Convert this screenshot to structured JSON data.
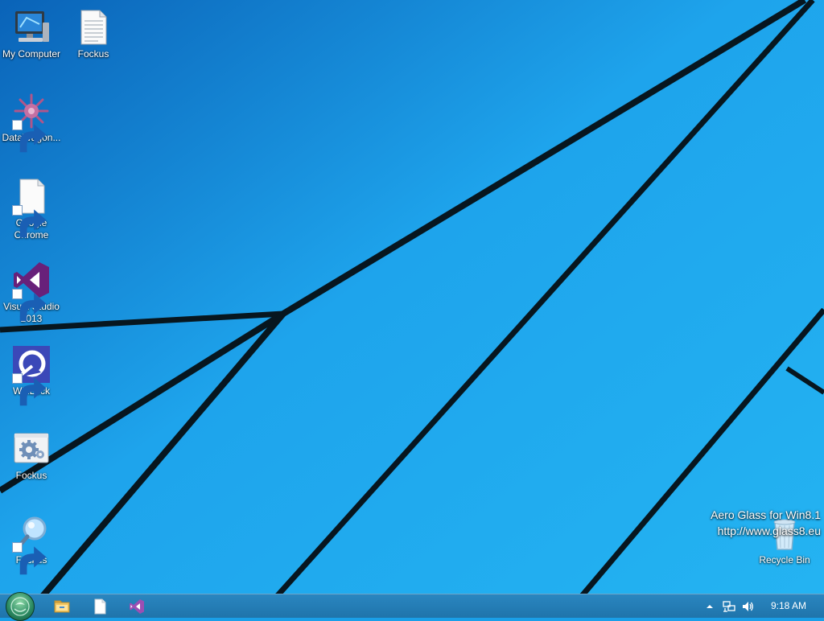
{
  "desktop": {
    "icons": [
      {
        "label": "My Computer",
        "icon": "computer-icon",
        "shortcut": false
      },
      {
        "label": "Fockus",
        "icon": "text-file-icon",
        "shortcut": false
      },
      {
        "label": "DataWagon...",
        "icon": "datawagon-icon",
        "shortcut": true
      },
      {
        "label": "Google\nChrome",
        "icon": "blank-file-icon",
        "shortcut": true
      },
      {
        "label": "Visual Studio\n2013",
        "icon": "visual-studio-icon",
        "shortcut": true
      },
      {
        "label": "WinLock",
        "icon": "winlock-icon",
        "shortcut": true
      },
      {
        "label": "Fockus",
        "icon": "gear-icon",
        "shortcut": false
      },
      {
        "label": "Fockus",
        "icon": "magnifier-icon",
        "shortcut": true
      },
      {
        "label": "Recycle Bin",
        "icon": "recycle-bin-icon",
        "shortcut": false
      }
    ]
  },
  "watermark": {
    "line1": "Aero Glass for Win8.1",
    "line2": "http://www.glass8.eu"
  },
  "taskbar": {
    "start": "start-orb-icon",
    "pinned": [
      "file-explorer-icon",
      "blank-file-icon",
      "visual-studio-icon"
    ],
    "tray": [
      "show-hidden-icons-icon",
      "network-icon",
      "volume-icon"
    ],
    "clock": "9:18 AM"
  },
  "colors": {
    "wallpaper_light": "#2bb6f2",
    "wallpaper_dark": "#0a5fb0",
    "taskbar": "#2480ba",
    "lines": "#061820"
  }
}
